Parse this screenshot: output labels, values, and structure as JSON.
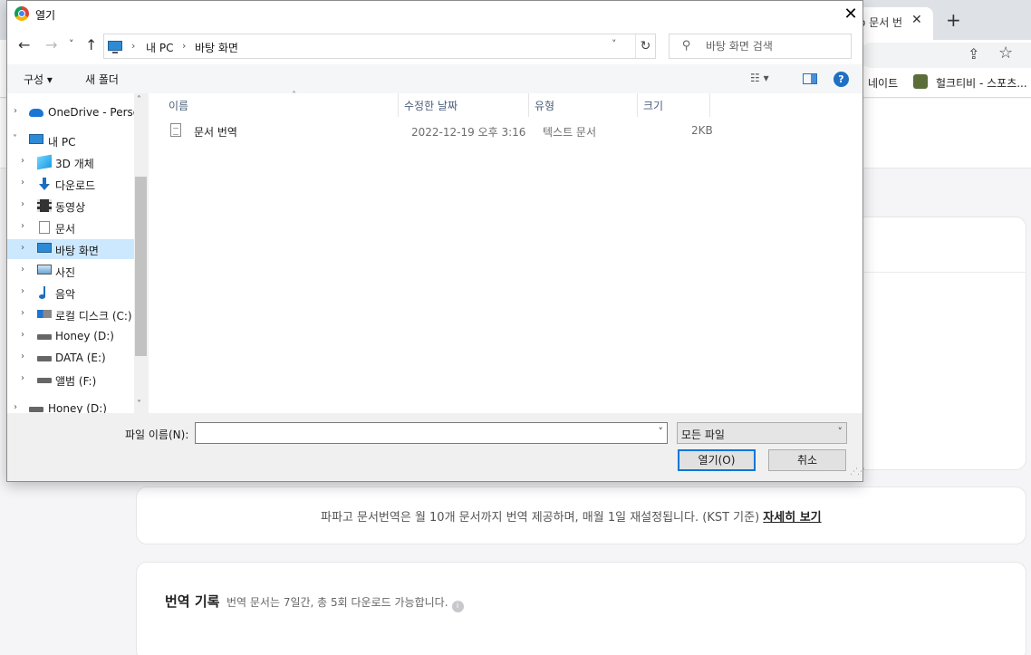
{
  "browser": {
    "tab_title": "o 문서 번",
    "tab_close": "✕",
    "new_tab": "+",
    "bookmarks": [
      "네이트",
      "헐크티비 - 스포츠..."
    ]
  },
  "page": {
    "notice_text": "파파고 문서번역은 월 10개 문서까지 번역 제공하며, 매월 1일 재설정됩니다. (KST 기준) ",
    "notice_link": "자세히 보기",
    "history_title": "번역 기록",
    "history_desc": "번역 문서는 7일간, 총 5회 다운로드 가능합니다."
  },
  "dialog": {
    "title": "열기",
    "close": "✕",
    "nav": {
      "back": "←",
      "forward": "→",
      "recent": "˅",
      "up": "↑"
    },
    "address": {
      "segments": [
        "내 PC",
        "바탕 화면"
      ],
      "separator": "›",
      "dropdown": "˅",
      "refresh": "↻"
    },
    "search": {
      "placeholder": "바탕 화면 검색",
      "icon": "⚲"
    },
    "commands": {
      "organize": "구성 ▾",
      "new_folder": "새 폴더",
      "view": "☷ ▾",
      "help": "?"
    },
    "tree": [
      {
        "label": "OneDrive - Personal",
        "icon": "onedrive-icon",
        "level": 0,
        "expanded": false
      },
      {
        "label": "내 PC",
        "icon": "pc-icon",
        "level": 0,
        "expanded": true
      },
      {
        "label": "3D 개체",
        "icon": "3d-objects-icon",
        "level": 1
      },
      {
        "label": "다운로드",
        "icon": "download-icon",
        "level": 1
      },
      {
        "label": "동영상",
        "icon": "video-icon",
        "level": 1
      },
      {
        "label": "문서",
        "icon": "document-icon",
        "level": 1
      },
      {
        "label": "바탕 화면",
        "icon": "desktop-icon",
        "level": 1,
        "selected": true
      },
      {
        "label": "사진",
        "icon": "pictures-icon",
        "level": 1
      },
      {
        "label": "음악",
        "icon": "music-icon",
        "level": 1
      },
      {
        "label": "로컬 디스크 (C:)",
        "icon": "local-disk-icon",
        "level": 1
      },
      {
        "label": "Honey (D:)",
        "icon": "drive-icon",
        "level": 1
      },
      {
        "label": "DATA (E:)",
        "icon": "drive-icon",
        "level": 1
      },
      {
        "label": "앨범 (F:)",
        "icon": "drive-icon",
        "level": 1
      },
      {
        "label": "Honey (D:)",
        "icon": "drive-icon",
        "level": 0
      }
    ],
    "columns": [
      "이름",
      "수정한 날짜",
      "유형",
      "크기"
    ],
    "files": [
      {
        "name": "문서 번역",
        "modified": "2022-12-19 오후 3:16",
        "type": "텍스트 문서",
        "size": "2KB"
      }
    ],
    "filename_label": "파일 이름(N):",
    "filename_value": "",
    "filetype": "모든 파일",
    "open_button": "열기(O)",
    "cancel_button": "취소"
  },
  "colors": {
    "selected_bg": "#cce8ff",
    "accent": "#0078d7",
    "column_text": "#4c607a"
  }
}
